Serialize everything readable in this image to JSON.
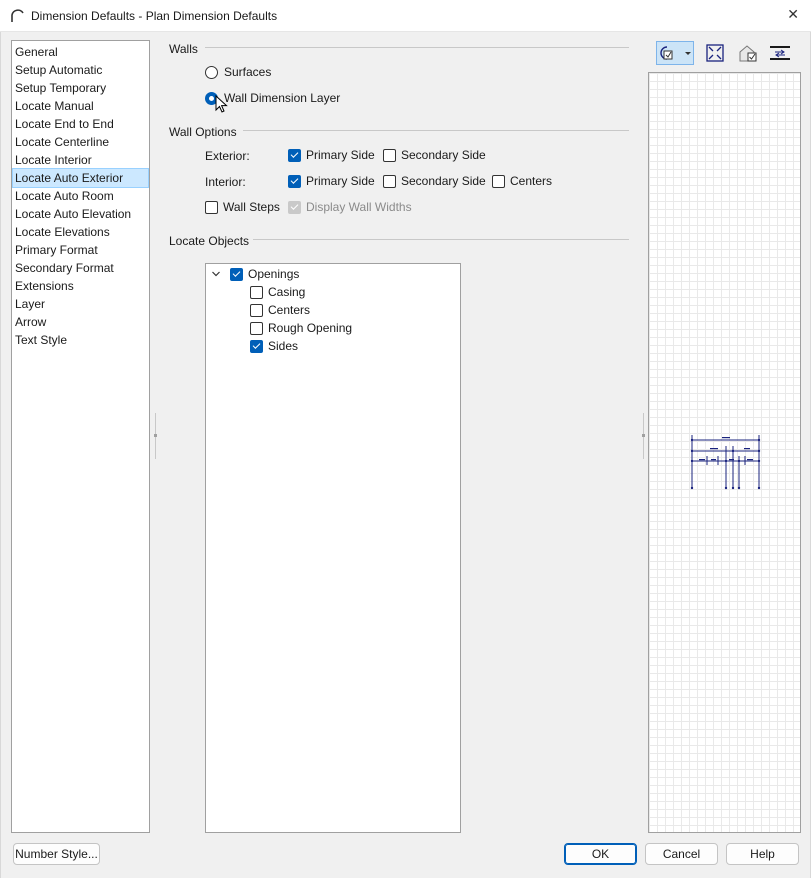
{
  "window": {
    "title": "Dimension Defaults - Plan Dimension Defaults"
  },
  "categories": [
    "General",
    "Setup Automatic",
    "Setup Temporary",
    "Locate Manual",
    "Locate End to End",
    "Locate Centerline",
    "Locate Interior",
    "Locate Auto Exterior",
    "Locate Auto Room",
    "Locate Auto Elevation",
    "Locate Elevations",
    "Primary Format",
    "Secondary Format",
    "Extensions",
    "Layer",
    "Arrow",
    "Text Style"
  ],
  "selected_category": "Locate Auto Exterior",
  "walls": {
    "heading": "Walls",
    "surfaces_label": "Surfaces",
    "surfaces_selected": false,
    "layer_label": "Wall Dimension Layer",
    "layer_selected": true
  },
  "wall_options": {
    "heading": "Wall Options",
    "exterior_label": "Exterior:",
    "interior_label": "Interior:",
    "primary_side": "Primary Side",
    "secondary_side": "Secondary Side",
    "centers": "Centers",
    "wall_steps": "Wall Steps",
    "display_wall_widths": "Display Wall Widths"
  },
  "locate_objects": {
    "heading": "Locate Objects",
    "parent": {
      "label": "Openings",
      "checked": true
    },
    "children": [
      {
        "label": "Casing",
        "checked": false
      },
      {
        "label": "Centers",
        "checked": false
      },
      {
        "label": "Rough Opening",
        "checked": false
      },
      {
        "label": "Sides",
        "checked": true
      }
    ]
  },
  "toolbar": {
    "icons": [
      "view-dropdown-icon",
      "fit-window-icon",
      "3d-house-icon",
      "swap-icon"
    ]
  },
  "buttons": {
    "number_style": "Number Style...",
    "ok": "OK",
    "cancel": "Cancel",
    "help": "Help"
  },
  "colors": {
    "accent": "#005fb8",
    "selection": "#cce8ff",
    "preview_ink": "#1a237e"
  }
}
